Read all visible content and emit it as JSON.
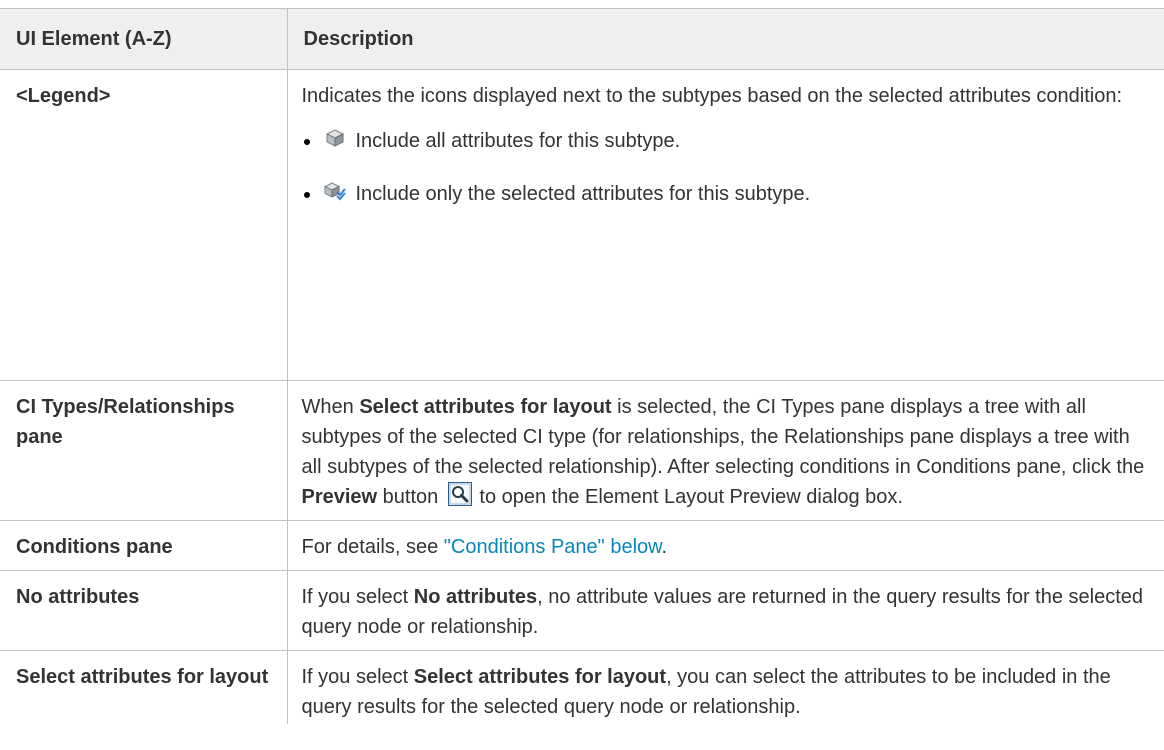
{
  "header": {
    "col_element": "UI Element (A-Z)",
    "col_description": "Description"
  },
  "rows": {
    "legend": {
      "term": "<Legend>",
      "intro": "Indicates the icons displayed next to the subtypes based on the selected attributes condition:",
      "items": [
        {
          "icon": "cube-icon",
          "text": "Include all attributes for this subtype."
        },
        {
          "icon": "cube-check-icon",
          "text": "Include only the selected attributes for this subtype."
        }
      ]
    },
    "ci_types": {
      "term": "CI Types/Relationships pane",
      "desc_pre": "When ",
      "desc_bold1": "Select attributes for layout",
      "desc_mid": " is selected, the CI Types pane displays a tree with all subtypes of the selected CI type (for relationships, the Relationships pane displays a tree with all subtypes of the selected relationship). After selecting conditions in Conditions pane, click the ",
      "desc_bold2": "Preview",
      "desc_button": " button ",
      "desc_post": " to open the Element Layout Preview dialog box.",
      "button_icon": "preview-magnifier-icon"
    },
    "conditions": {
      "term": "Conditions pane",
      "desc_pre": "For details, see ",
      "link_text": "\"Conditions Pane\" below",
      "desc_post": "."
    },
    "no_attributes": {
      "term": "No attributes",
      "desc_pre": "If you select ",
      "desc_bold": "No attributes",
      "desc_post": ", no attribute values are returned in the query results for the selected query node or relationship."
    },
    "select_attributes": {
      "term": "Select attributes for layout",
      "desc_pre": "If you select ",
      "desc_bold": "Select attributes for layout",
      "desc_post": ", you can select the attributes to be included in the query results for the selected query node or relationship."
    }
  },
  "colors": {
    "header_bg": "#efefef",
    "border": "#c2c2c2",
    "text": "#333333",
    "link": "#0a86b8"
  }
}
